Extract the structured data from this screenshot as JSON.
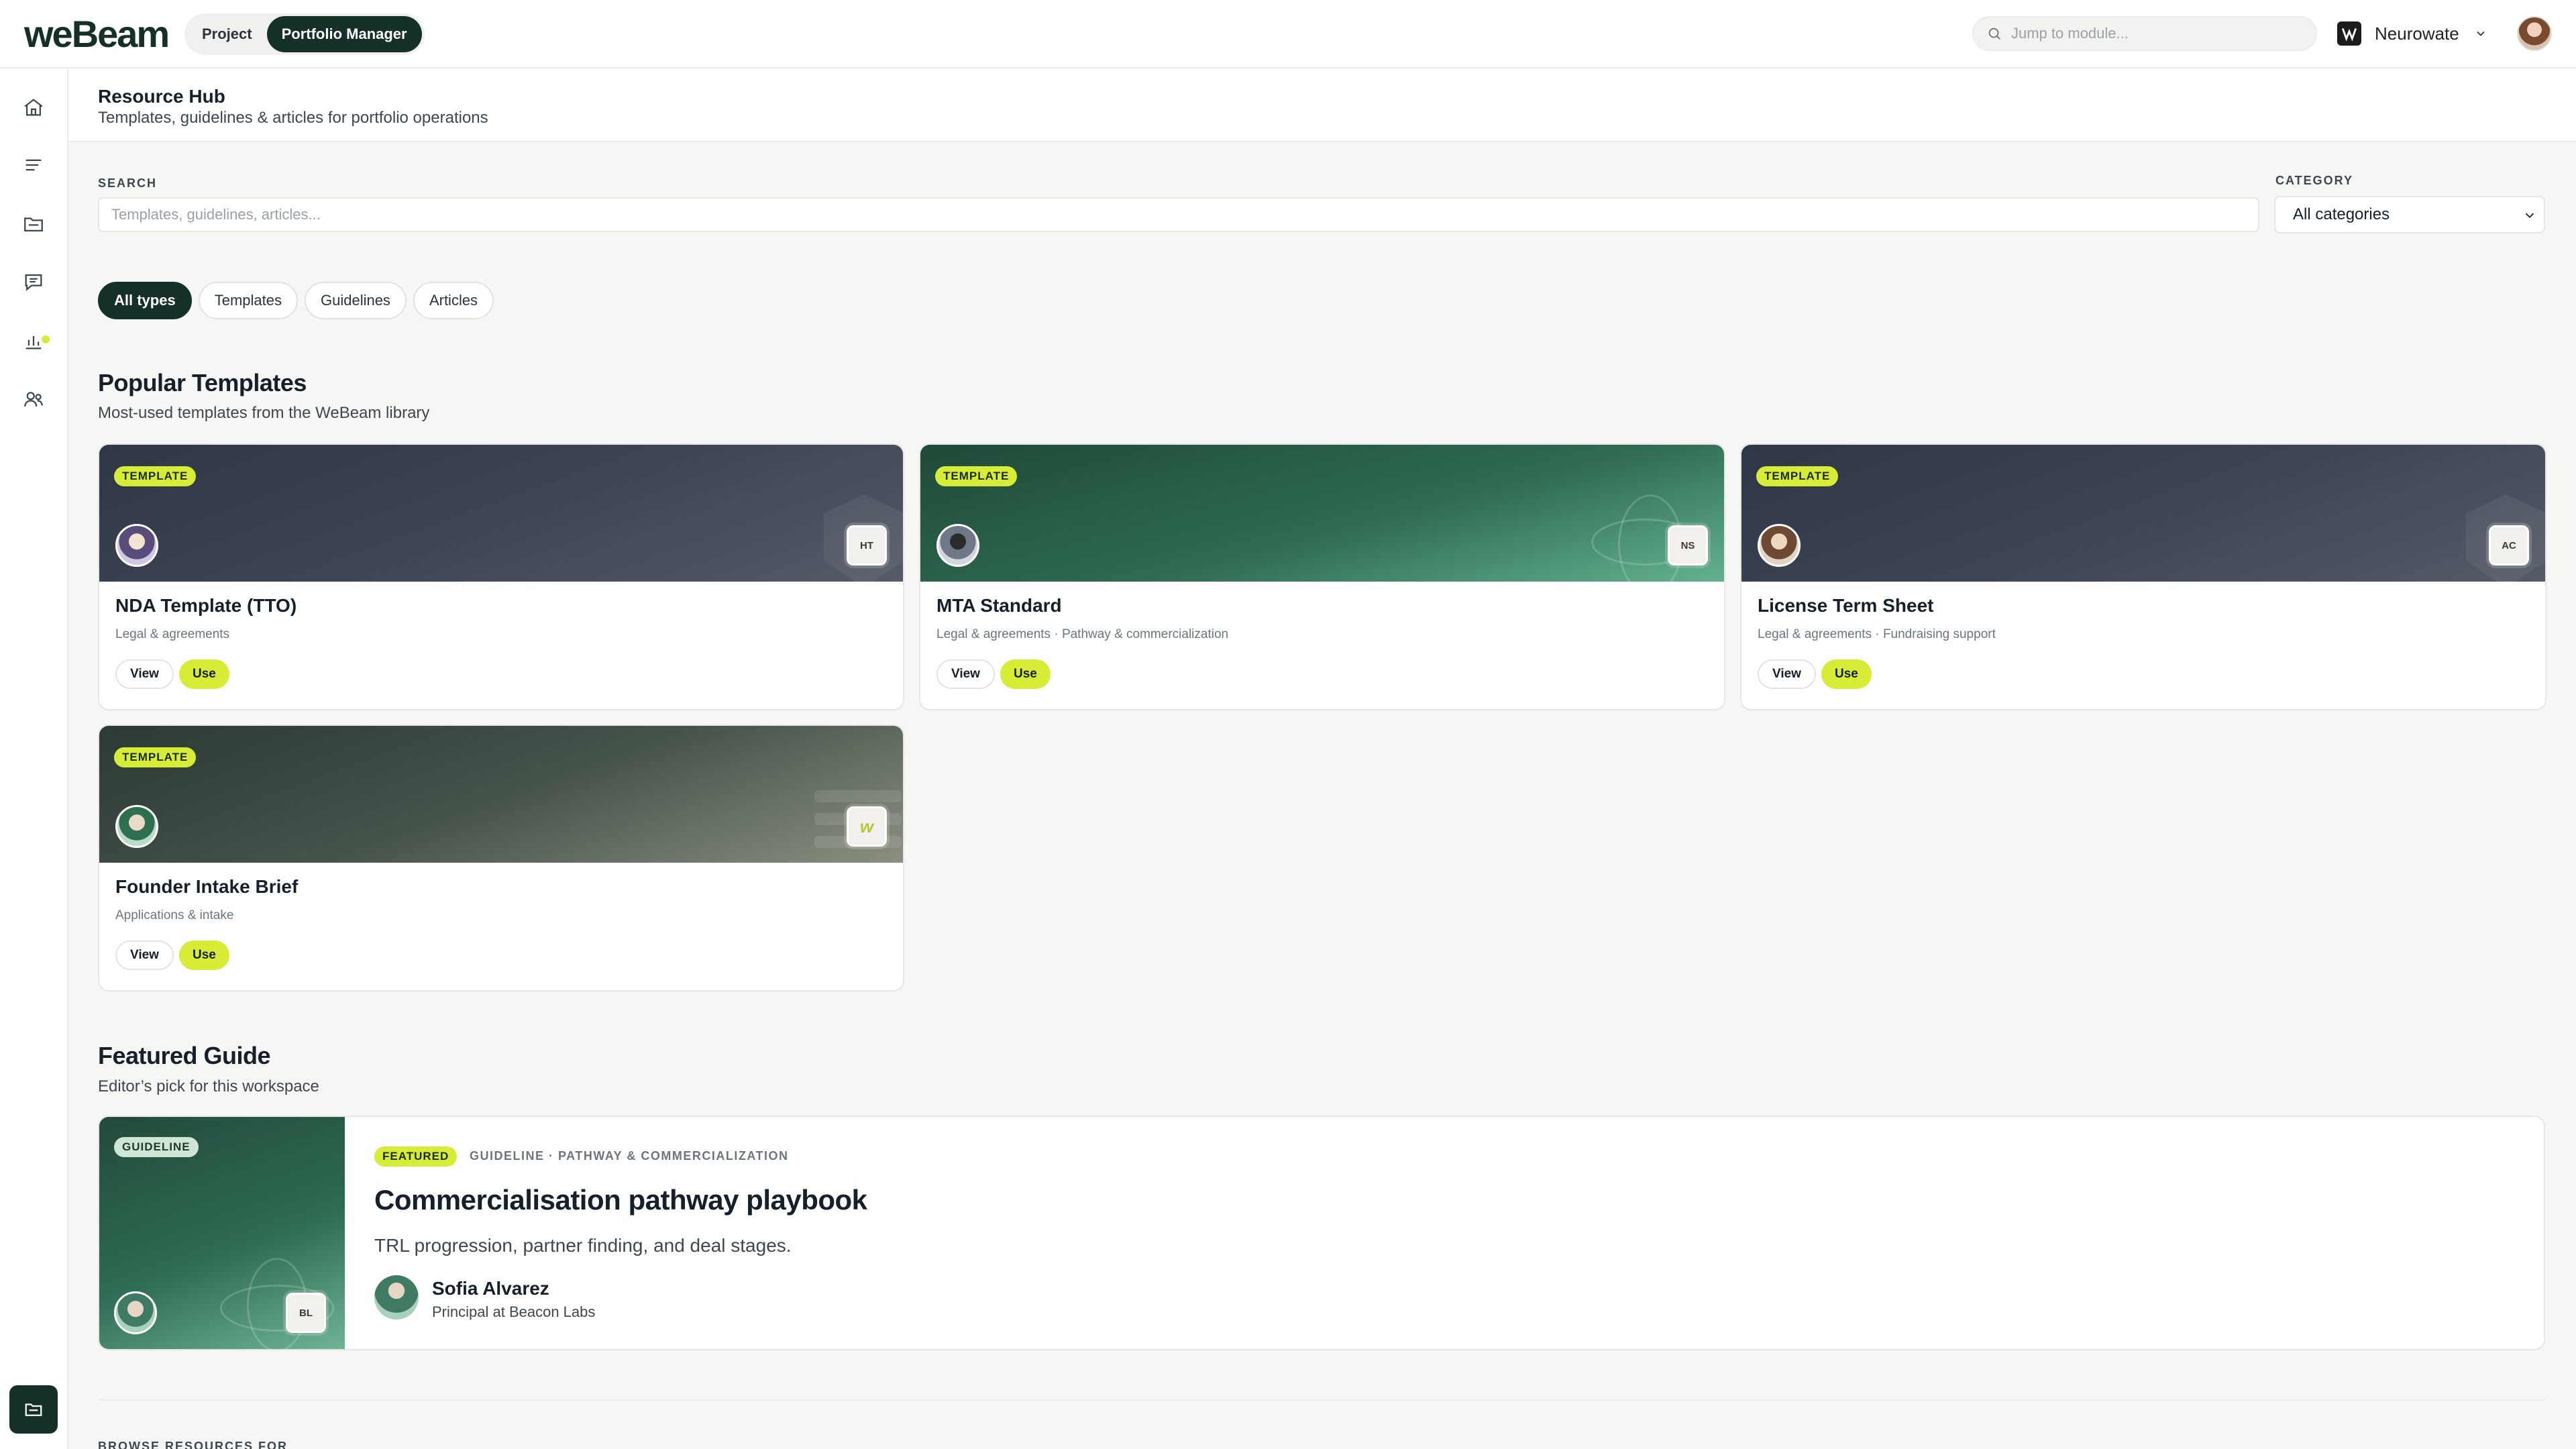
{
  "app": {
    "logo_text": "weBeam",
    "modes": [
      "Project",
      "Portfolio Manager"
    ],
    "active_mode": "Portfolio Manager"
  },
  "topbar": {
    "search_placeholder": "Jump to module...",
    "org_name": "Neurowate"
  },
  "page": {
    "title": "Resource Hub",
    "subtitle": "Templates, guidelines & articles for portfolio operations"
  },
  "filters": {
    "search_label": "SEARCH",
    "search_placeholder": "Templates, guidelines, articles...",
    "category_label": "CATEGORY",
    "category_value": "All categories",
    "chips": [
      "All types",
      "Templates",
      "Guidelines",
      "Articles"
    ],
    "active_chip": "All types"
  },
  "popular": {
    "title": "Popular Templates",
    "subtitle": "Most-used templates from the WeBeam library",
    "cards": [
      {
        "badge": "TEMPLATE",
        "title": "NDA Template (TTO)",
        "category": "Legal & agreements",
        "mono": "HT",
        "view": "View",
        "use": "Use"
      },
      {
        "badge": "TEMPLATE",
        "title": "MTA Standard",
        "category": "Legal & agreements · Pathway & commercialization",
        "mono": "NS",
        "view": "View",
        "use": "Use"
      },
      {
        "badge": "TEMPLATE",
        "title": "License Term Sheet",
        "category": "Legal & agreements · Fundraising support",
        "mono": "AC",
        "view": "View",
        "use": "Use"
      },
      {
        "badge": "TEMPLATE",
        "title": "Founder Intake Brief",
        "category": "Applications & intake",
        "mono": "w",
        "view": "View",
        "use": "Use"
      }
    ]
  },
  "featured": {
    "title": "Featured Guide",
    "subtitle": "Editor’s pick for this workspace",
    "image_badge": "GUIDELINE",
    "image_mono": "BL",
    "badge": "FEATURED",
    "meta": "GUIDELINE · PATHWAY & COMMERCIALIZATION",
    "headline": "Commercialisation pathway playbook",
    "description": "TRL progression, partner finding, and deal stages.",
    "author_name": "Sofia Alvarez",
    "author_role": "Principal at Beacon Labs"
  },
  "browse_label": "BROWSE RESOURCES FOR",
  "colors": {
    "brand_dark": "#143029",
    "accent_lime": "#d7ec36",
    "background": "#f6f6f4"
  }
}
